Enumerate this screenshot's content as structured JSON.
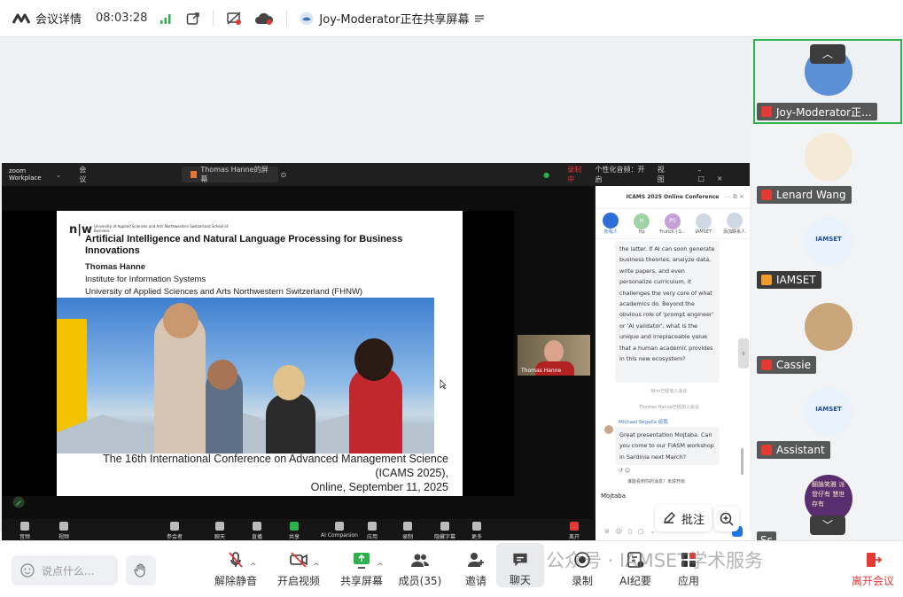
{
  "topbar": {
    "meeting_info": "会议详情",
    "time": "08:03:28",
    "share_notice": "Joy-Moderator正在共享屏幕"
  },
  "rail": {
    "tiles": [
      {
        "name": "Joy-Moderator正...",
        "color": "#5b8fd6"
      },
      {
        "name": "Lenard Wang",
        "color": "#f5e9d8"
      },
      {
        "name": "IAMSET",
        "color": "#e9f1fb"
      },
      {
        "name": "Cassie",
        "color": "#caa77a"
      },
      {
        "name": "Assistant",
        "color": "#e9f1fb"
      },
      {
        "name": "Ss",
        "color": "#5a2d6e"
      }
    ],
    "avatar_text": "IAMSET",
    "bottom_avatar_text": "翻論笑雅 派發仔有 慧世存有"
  },
  "inner": {
    "brand": "zoom Workplace",
    "menu": "会议",
    "tab": "Thomas Hanne的屏幕",
    "rec": "录制中",
    "status": "个性化音频：开启",
    "view": "视图",
    "bar": [
      "音频",
      "视频",
      "参会者",
      "聊天",
      "直播",
      "共享",
      "AI Companion",
      "应用",
      "录制",
      "隐藏字幕",
      "更多",
      "离开"
    ],
    "participant_label": "Thomas Hanne"
  },
  "slide": {
    "logo": "n|w",
    "logo_sub": "University of Applied Sciences and Arts Northwestern Switzerland School of Business",
    "title": "Artificial Intelligence and Natural Language Processing for Business Innovations",
    "author": "Thomas Hanne",
    "affil1": "Institute for Information Systems",
    "affil2": "University of Applied Sciences and Arts Northwestern Switzerland (FHNW)",
    "conf1": "The 16th International Conference on Advanced Management Science",
    "conf2": "(ICAMS 2025),",
    "conf3": "Online, September 11, 2025"
  },
  "chat": {
    "title": "ICAMS 2025 Online Conference",
    "tabs": [
      "所有人",
      "Hp",
      "Fruitck | S...",
      "IAMSET",
      "添加联系人"
    ],
    "tab_initials": [
      "",
      "H",
      "PS",
      "",
      ""
    ],
    "msg1": "the latter. If AI can soon generate business theories, analyze data, write papers, and even personalize curriculum, it challenges the very core of what academics do. Beyond the obvious role of 'prompt engineer' or 'AI validator', what is the unique and irreplaceable value that a human academic provides in this new ecosystem?",
    "sys1": "Wim已经加入会议",
    "sys2": "Thomas Hanne已经加入会议",
    "sender": "Michael Segalla 给我",
    "msg2": "Great presentation Mojtaba. Can you come to our FIASM workshop in Sardinia next March?",
    "hint": "谁能看到你的消息？未获开启",
    "input": "Mojtaba"
  },
  "annot": {
    "label": "批注"
  },
  "bottom": {
    "chat_placeholder": "说点什么...",
    "items": [
      "解除静音",
      "开启视频",
      "共享屏幕",
      "成员(35)",
      "邀请",
      "聊天",
      "录制",
      "AI纪要",
      "应用",
      "离开会议"
    ],
    "watermark": "公众号 · IAMSET学术服务"
  }
}
